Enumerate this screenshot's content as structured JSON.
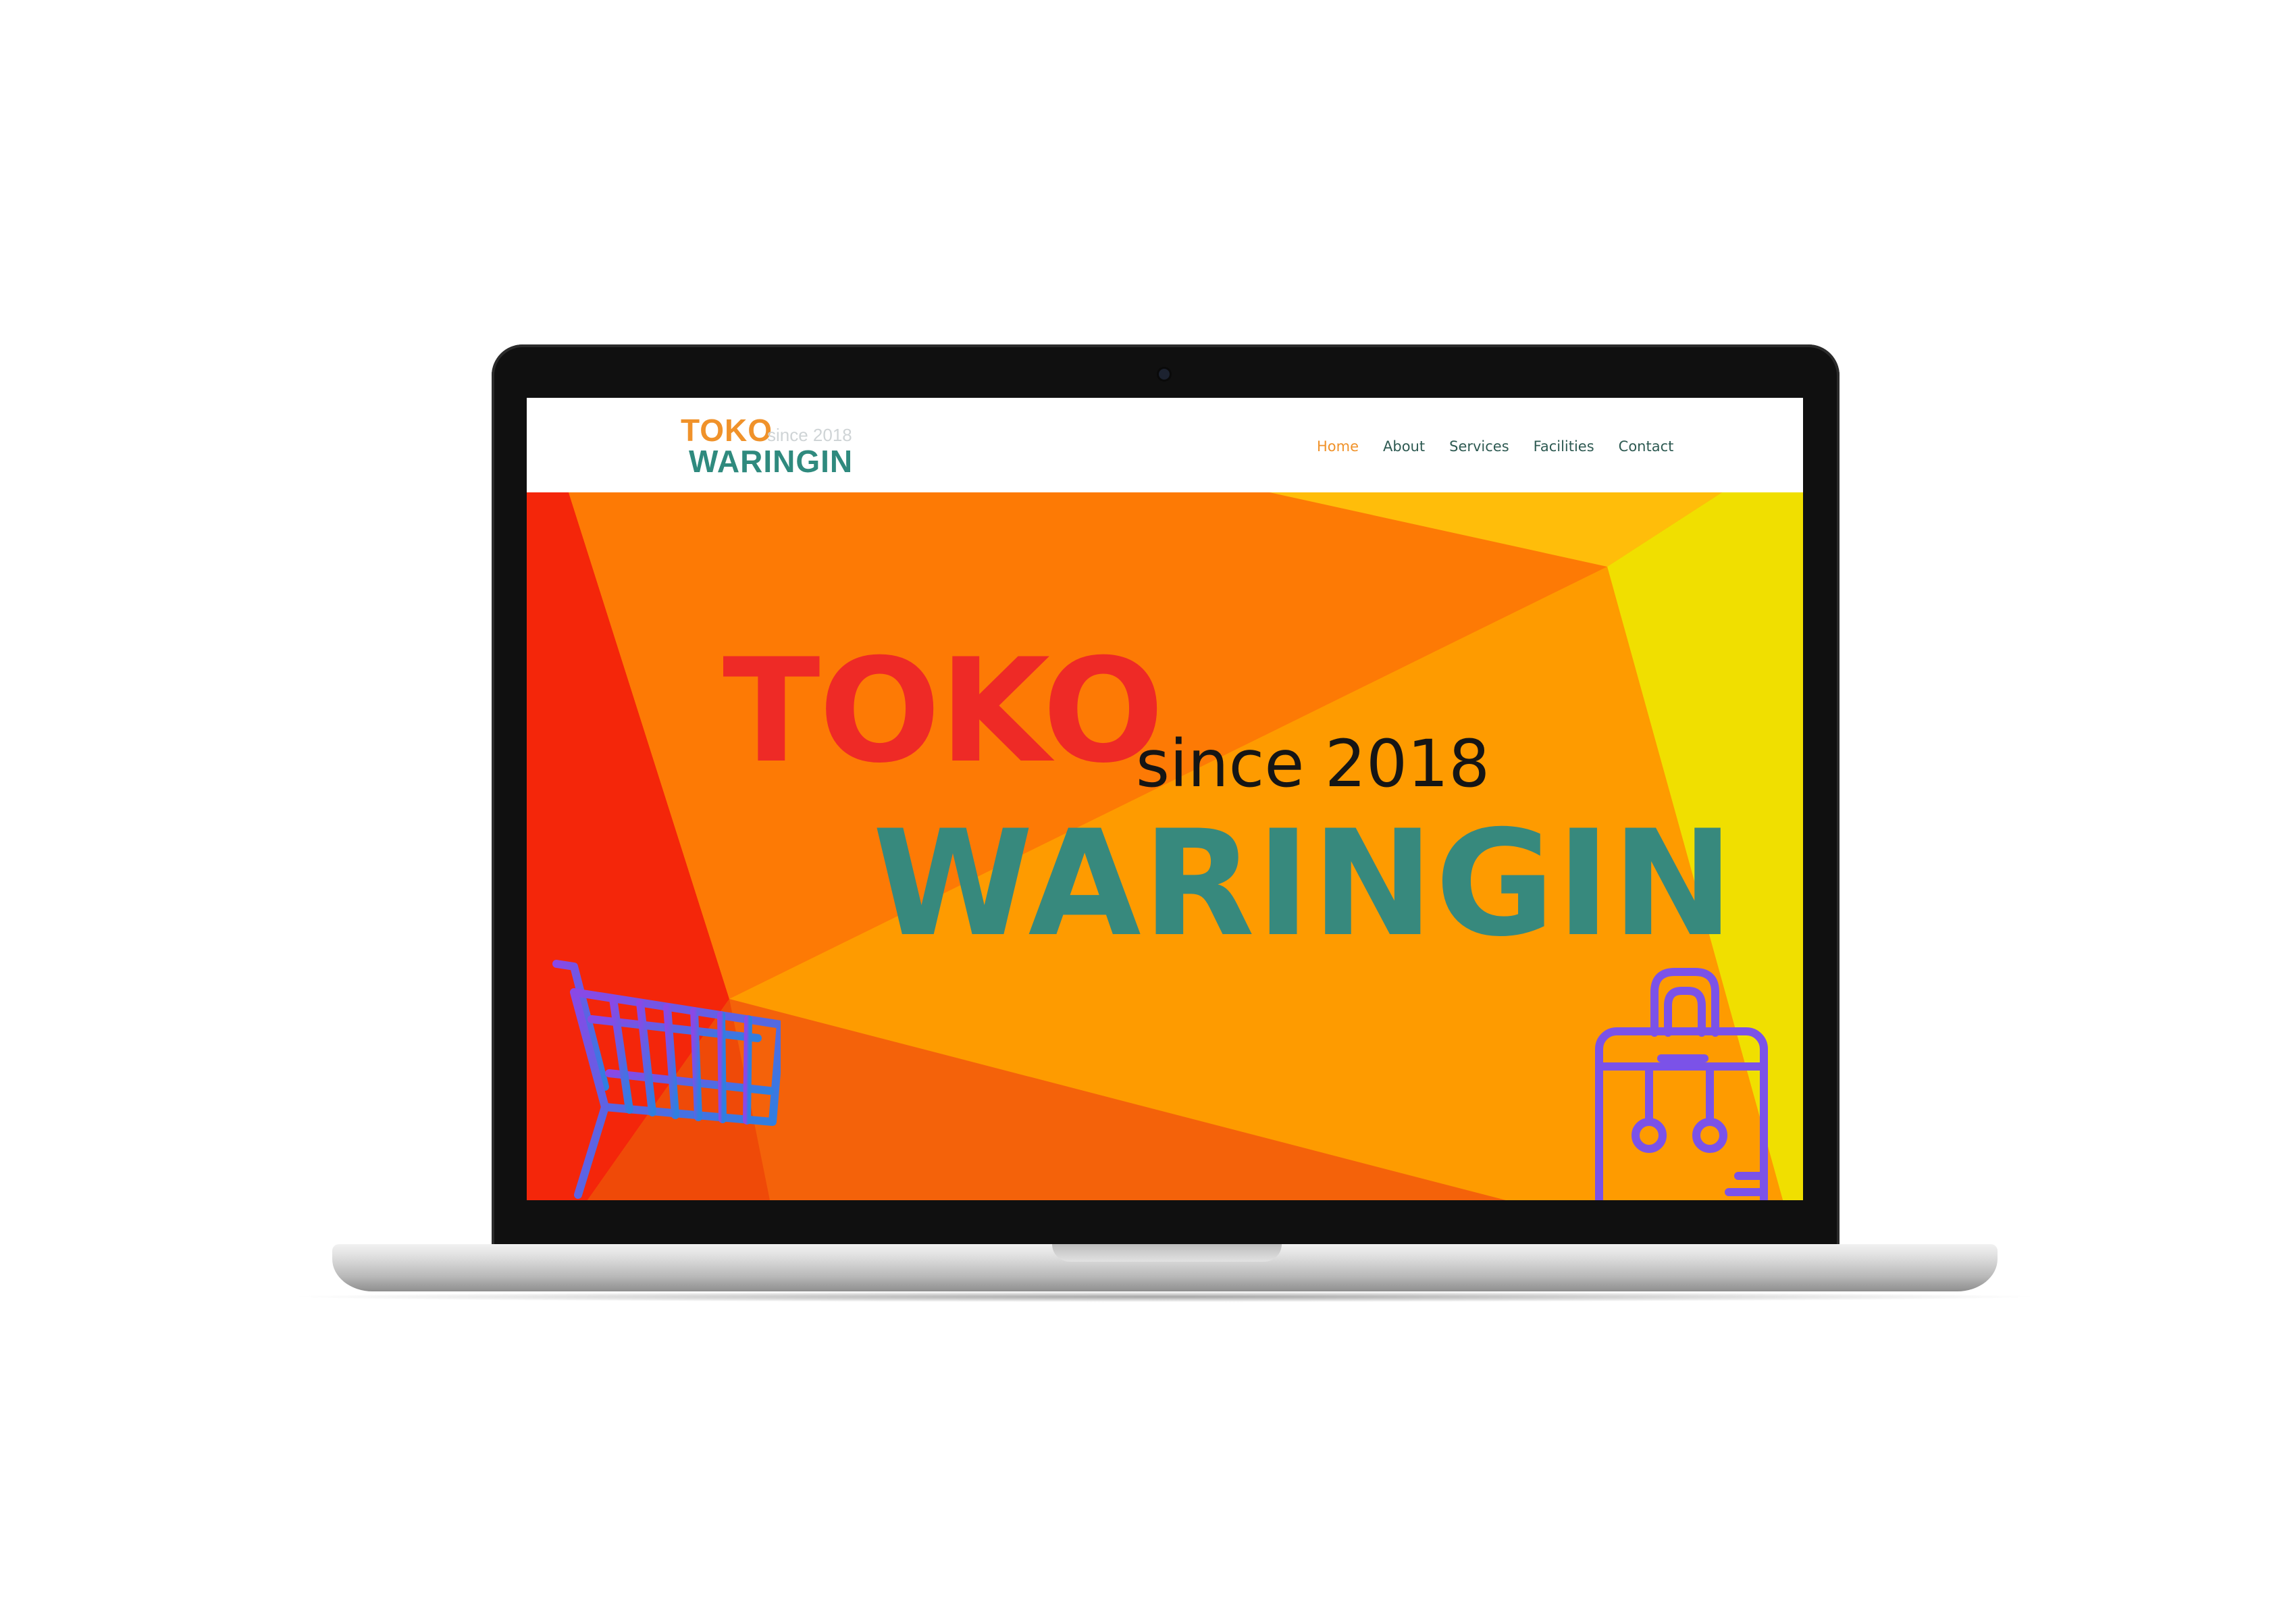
{
  "site": {
    "logo": {
      "word_top": "TOKO",
      "since": "since 2018",
      "word_bottom": "WARINGIN"
    },
    "nav": [
      {
        "label": "Home",
        "active": true
      },
      {
        "label": "About",
        "active": false
      },
      {
        "label": "Services",
        "active": false
      },
      {
        "label": "Facilities",
        "active": false
      },
      {
        "label": "Contact",
        "active": false
      }
    ],
    "hero": {
      "title_top": "TOKO",
      "since": "since 2018",
      "title_bottom": "WARINGIN",
      "icons": [
        "shopping-cart-icon",
        "luggage-bag-icon"
      ]
    }
  },
  "colors": {
    "brand_orange": "#f0922a",
    "brand_teal": "#2f8a7e",
    "hero_red": "#ee2a26",
    "nav_text": "#2e5a52"
  }
}
